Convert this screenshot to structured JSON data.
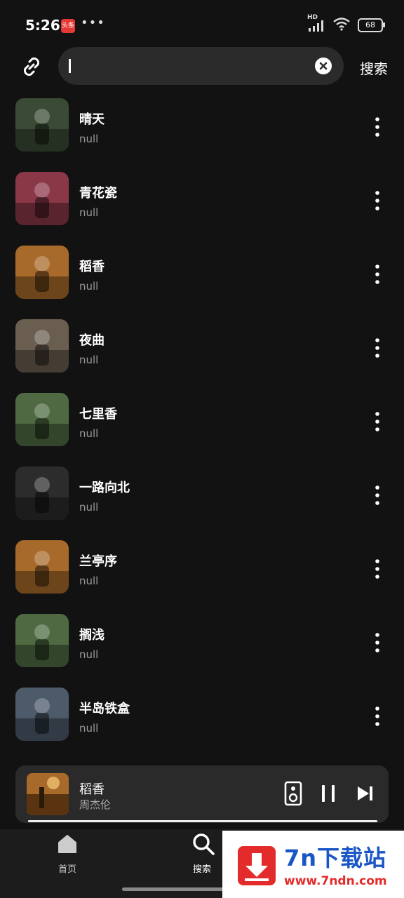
{
  "status_bar": {
    "time": "5:26",
    "app_badge": "头条",
    "dots": "•••",
    "network_label": "HD",
    "battery": "68"
  },
  "search": {
    "link_icon": "link-icon",
    "clear_icon": "close-circle-icon",
    "button_label": "搜索"
  },
  "songs": [
    {
      "title": "晴天",
      "artist": "null",
      "cover_color": "#3a4a35"
    },
    {
      "title": "青花瓷",
      "artist": "null",
      "cover_color": "#8a3848"
    },
    {
      "title": "稻香",
      "artist": "null",
      "cover_color": "#a86a2a"
    },
    {
      "title": "夜曲",
      "artist": "null",
      "cover_color": "#6a5e50"
    },
    {
      "title": "七里香",
      "artist": "null",
      "cover_color": "#4f6a42"
    },
    {
      "title": "一路向北",
      "artist": "null",
      "cover_color": "#2c2c2c"
    },
    {
      "title": "兰亭序",
      "artist": "null",
      "cover_color": "#a86a2a"
    },
    {
      "title": "搁浅",
      "artist": "null",
      "cover_color": "#4f6a42"
    },
    {
      "title": "半岛铁盒",
      "artist": "null",
      "cover_color": "#4c5a6a"
    }
  ],
  "player": {
    "title": "稻香",
    "artist": "周杰伦",
    "progress": 1.0,
    "icons": [
      "speaker-icon",
      "pause-icon",
      "skip-next-icon"
    ]
  },
  "bottom_nav": [
    {
      "label": "首页",
      "icon": "home-icon"
    },
    {
      "label": "搜索",
      "icon": "search-icon"
    }
  ],
  "watermark": {
    "title": "7n下载站",
    "url": "www.7ndn.com"
  },
  "colors": {
    "background": "#121212",
    "surface": "#2b2b2b",
    "secondary_text": "#9a9a9a",
    "watermark_blue": "#1a56c6",
    "watermark_red": "#e32b2b"
  }
}
